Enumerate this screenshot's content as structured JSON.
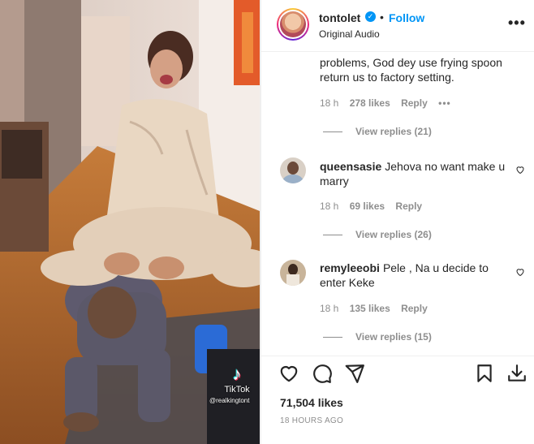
{
  "post": {
    "username": "tontolet",
    "separator": "•",
    "follow_label": "Follow",
    "audio_label": "Original Audio",
    "more_label": "•••",
    "verified_glyph": "✓"
  },
  "overlay": {
    "tiktok_glyph": "♪",
    "tiktok_label": "TikTok",
    "tiktok_handle": "@realkingtont"
  },
  "comments": [
    {
      "username": "",
      "text": "problems, God dey use frying spoon return us to factory setting.",
      "time": "18 h",
      "likes": "278 likes",
      "reply": "Reply",
      "more": "•••",
      "view_replies": "View replies (21)"
    },
    {
      "username": "queensasie",
      "text": "Jehova no want make u marry",
      "time": "18 h",
      "likes": "69 likes",
      "reply": "Reply",
      "view_replies": "View replies (26)"
    },
    {
      "username": "remyleeobi",
      "text": "Pele , Na u decide to enter Keke",
      "time": "18 h",
      "likes": "135 likes",
      "reply": "Reply",
      "view_replies": "View replies (15)"
    }
  ],
  "footer": {
    "likes": "71,504 likes",
    "timestamp": "18 HOURS AGO"
  },
  "icons": {
    "like": "heart-icon",
    "comment": "comment-icon",
    "share": "share-icon",
    "save": "bookmark-icon",
    "download": "download-icon"
  }
}
